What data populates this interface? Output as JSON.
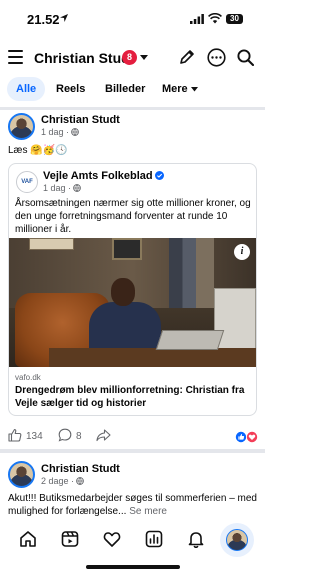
{
  "status_bar": {
    "time": "21.52",
    "battery": "30"
  },
  "header": {
    "title": "Christian Studt",
    "notification_count": "8"
  },
  "tabs": [
    {
      "label": "Alle",
      "active": true
    },
    {
      "label": "Reels",
      "active": false
    },
    {
      "label": "Billeder",
      "active": false
    },
    {
      "label": "Mere",
      "active": false
    }
  ],
  "post1": {
    "author": "Christian Studt",
    "time": "1 dag ·",
    "text": "Læs 🤗🥳🕓",
    "shared": {
      "page_name": "Vejle Amts Folkeblad",
      "logo_text": "VAF",
      "time": "1 dag ·",
      "text": "Årsomsætningen nærmer sig otte millioner kroner, og den unge forretningsmand forventer at runde 10 millioner i år.",
      "link_domain": "vafo.dk",
      "link_title": "Drengedrøm blev millionforretning: Christian fra Vejle sælger tid og historier"
    },
    "likes": "134",
    "comments": "8"
  },
  "post2": {
    "author": "Christian Studt",
    "time": "2 dage ·",
    "text": "Akut!!! Butiksmedarbejder søges til sommerferien – med mulighed for forlængelse...",
    "see_more": "Se mere"
  },
  "colors": {
    "accent": "#0866ff",
    "badge": "#e41e3f",
    "separator": "#e4e6eb"
  },
  "bottom_nav": [
    "home-icon",
    "video-icon",
    "heart-icon",
    "dashboard-icon",
    "bell-icon",
    "profile-avatar"
  ]
}
